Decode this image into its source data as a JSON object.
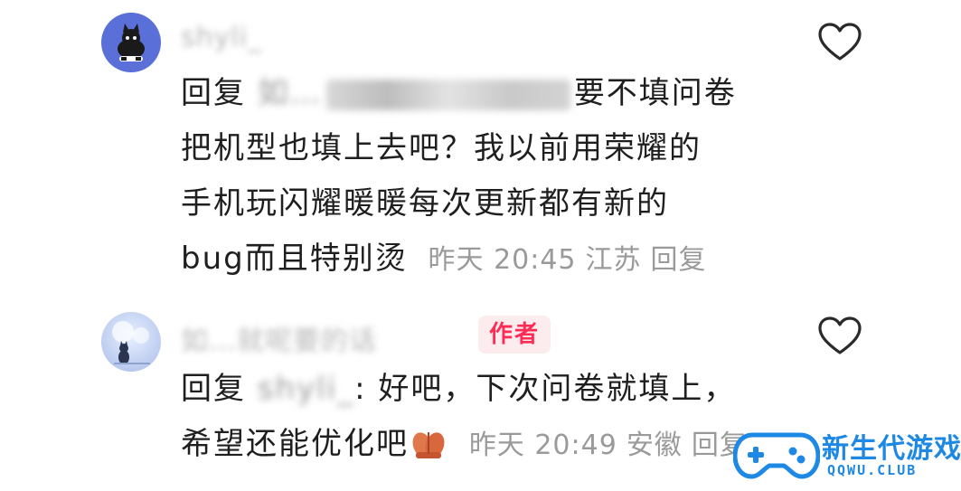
{
  "comments": [
    {
      "username": "shyli_",
      "reply_prefix": "回复",
      "lines": [
        {
          "blurred": "如…",
          "text": "要不填问卷"
        },
        {
          "text": "把机型也填上去吧？我以前用荣耀的"
        },
        {
          "text": "手机玩闪耀暖暖每次更新都有新的"
        },
        {
          "text": "bug而且特别烫"
        }
      ],
      "time": "昨天 20:45",
      "location": "江苏",
      "reply_label": "回复",
      "liked": false
    },
    {
      "username": "如…就呢要的话",
      "badge": "作者",
      "reply_prefix": "回复",
      "reply_to": "shyli_",
      "lines": [
        {
          "text": ": 好吧，下次问卷就填上，"
        },
        {
          "text": "希望还能优化吧"
        }
      ],
      "emoji": "folded-hands",
      "time": "昨天 20:49",
      "location": "安徽",
      "reply_label": "回复",
      "liked": false
    }
  ],
  "watermark": {
    "title": "新生代游戏",
    "domain": "QQWU.CLUB"
  },
  "colors": {
    "text": "#1f1f1f",
    "meta": "#9a9a9a",
    "badge_bg": "#fdecee",
    "badge_text": "#fe2c55",
    "watermark": "#1e88e5"
  }
}
